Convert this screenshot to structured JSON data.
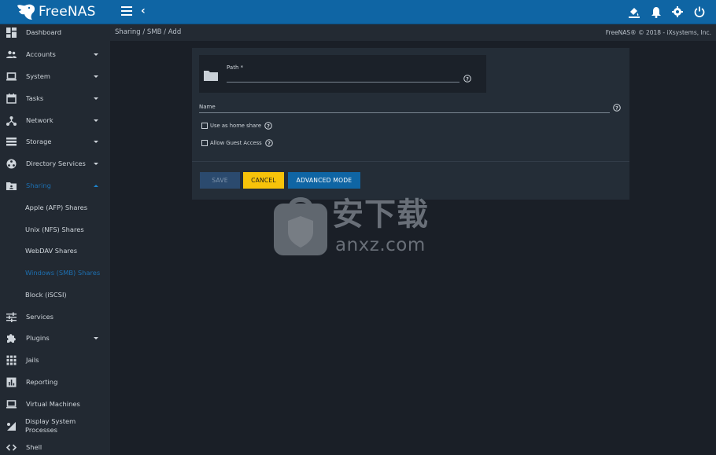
{
  "app": {
    "logo_text": "FreeNAS"
  },
  "sidebar": {
    "items": [
      {
        "label": "Dashboard",
        "icon": "dashboard-icon",
        "arrow": false
      },
      {
        "label": "Accounts",
        "icon": "people-icon",
        "arrow": true
      },
      {
        "label": "System",
        "icon": "laptop-icon",
        "arrow": true
      },
      {
        "label": "Tasks",
        "icon": "calendar-icon",
        "arrow": true
      },
      {
        "label": "Network",
        "icon": "network-icon",
        "arrow": true
      },
      {
        "label": "Storage",
        "icon": "storage-icon",
        "arrow": true
      },
      {
        "label": "Directory Services",
        "icon": "directory-icon",
        "arrow": true
      },
      {
        "label": "Sharing",
        "icon": "sharing-icon",
        "arrow": true,
        "expanded": true
      },
      {
        "label": "Apple (AFP) Shares"
      },
      {
        "label": "Unix (NFS) Shares"
      },
      {
        "label": "WebDAV Shares"
      },
      {
        "label": "Windows (SMB) Shares",
        "active": true
      },
      {
        "label": "Block (iSCSI)"
      },
      {
        "label": "Services",
        "icon": "sliders-icon",
        "arrow": false
      },
      {
        "label": "Plugins",
        "icon": "puzzle-icon",
        "arrow": true
      },
      {
        "label": "Jails",
        "icon": "grid-icon",
        "arrow": false
      },
      {
        "label": "Reporting",
        "icon": "chart-icon",
        "arrow": false
      },
      {
        "label": "Virtual Machines",
        "icon": "laptop-icon",
        "arrow": false
      },
      {
        "label": "Display System Processes",
        "label_line1": "Display System",
        "label_line2": "Processes",
        "icon": "processes-icon",
        "arrow": false
      },
      {
        "label": "Shell",
        "icon": "code-icon",
        "arrow": false
      }
    ]
  },
  "breadcrumb": {
    "part1": "Sharing",
    "sep1": " / ",
    "part2": "SMB",
    "sep2": " / ",
    "part3": "Add"
  },
  "copyright": "FreeNAS® © 2018 - iXsystems, Inc.",
  "form": {
    "path_label": "Path *",
    "path_value": "",
    "name_label": "Name",
    "name_value": "",
    "home_share_label": "Use as home share",
    "guest_access_label": "Allow Guest Access",
    "home_share_checked": false,
    "guest_access_checked": false
  },
  "buttons": {
    "save": "SAVE",
    "cancel": "CANCEL",
    "advanced": "ADVANCED MODE"
  },
  "watermark": {
    "big": "安下载",
    "url": "anxz.com"
  },
  "colors": {
    "topbar": "#0f65a4",
    "sidebar": "#222932",
    "content_bg": "#1a1f27",
    "card": "#242d37",
    "accent": "#1d6fb0",
    "cancel": "#f7c30a"
  }
}
